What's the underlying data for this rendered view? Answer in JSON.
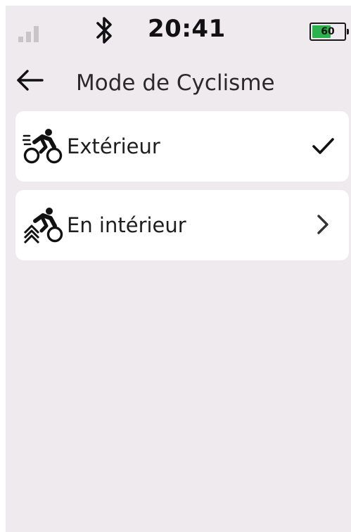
{
  "status_bar": {
    "time": "20:41",
    "battery_level": "60",
    "battery_percent": 60,
    "signal_icon": "signal-bars-icon",
    "bluetooth_icon": "bluetooth-icon"
  },
  "header": {
    "title": "Mode de Cyclisme",
    "back_icon": "arrow-left-icon"
  },
  "options": [
    {
      "label": "Extérieur",
      "icon": "outdoor-cycling-icon",
      "trailing_icon": "checkmark-icon",
      "selected": true
    },
    {
      "label": "En intérieur",
      "icon": "indoor-cycling-icon",
      "trailing_icon": "chevron-right-icon",
      "selected": false
    }
  ],
  "colors": {
    "background": "#efeaed",
    "card": "#ffffff",
    "battery_fill": "#2bb24c",
    "signal_inactive": "#c9c4c7"
  }
}
